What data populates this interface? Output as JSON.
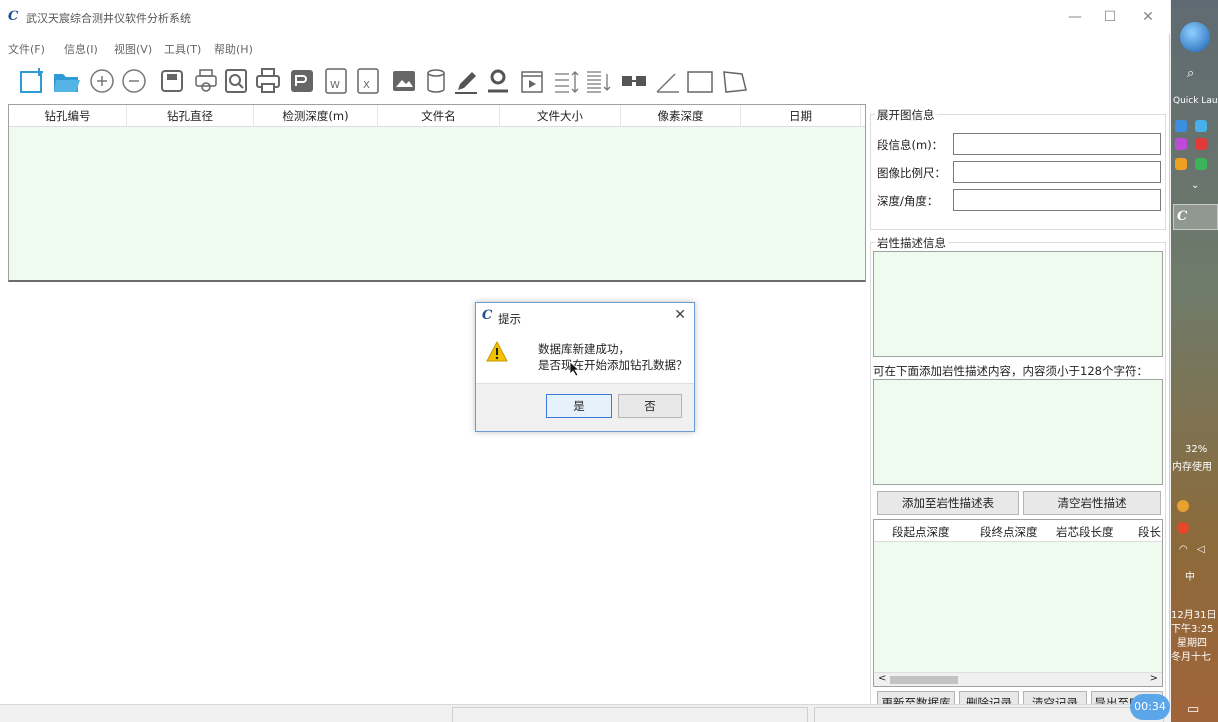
{
  "window": {
    "logo_text": "C",
    "title": "武汉天宸综合测井仪软件分析系统",
    "minimize_glyph": "—",
    "maximize_glyph": "☐",
    "close_glyph": "✕"
  },
  "menu": [
    "文件(F)",
    "信息(I)",
    "视图(V)",
    "工具(T)",
    "帮助(H)"
  ],
  "toolbar_icons": [
    "new-file-icon",
    "open-folder-icon",
    "zoom-in-icon",
    "zoom-out-icon",
    "save-icon",
    "print-setup-icon",
    "print-preview-icon",
    "print-icon",
    "export-image-icon",
    "export-word-icon",
    "export-excel-icon",
    "image-icon",
    "database-icon",
    "pencil-icon",
    "location-icon",
    "video-icon",
    "align-up-icon",
    "align-down-icon",
    "merge-icon",
    "angle-icon",
    "rectangle-icon",
    "polygon-icon"
  ],
  "drill_table": {
    "columns": [
      "钻孔编号",
      "钻孔直径",
      "检测深度(m)",
      "文件名",
      "文件大小",
      "像素深度",
      "日期"
    ]
  },
  "unfold_info": {
    "title": "展开图信息",
    "segment_label": "段信息(m)：",
    "scale_label": "图像比例尺：",
    "depth_angle_label": "深度/角度："
  },
  "lithology": {
    "title": "岩性描述信息",
    "hint": "可在下面添加岩性描述内容，内容须小于128个字符：",
    "add_button": "添加至岩性描述表",
    "clear_button": "清空岩性描述",
    "columns": [
      "段起点深度",
      "段终点深度",
      "岩芯段长度",
      "段长"
    ],
    "scroll_left": "<",
    "scroll_right": ">"
  },
  "actions": {
    "update_db": "更新至数据库",
    "delete_record": "删除记录",
    "clear_records": "清空记录",
    "export_excel": "导出至Excel"
  },
  "dialog": {
    "logo_text": "C",
    "title": "提示",
    "close_glyph": "✕",
    "line1": "数据库新建成功，",
    "line2": "是否现在开始添加钻孔数据？",
    "yes": "是",
    "no": "否"
  },
  "timer": "00:34",
  "taskbar": {
    "quick_launch": "Quick Launch",
    "memory_percent": "32%",
    "memory_label": "内存使用",
    "ime": "中",
    "date": "12月31日",
    "time": "下午3:25",
    "weekday": "星期四",
    "lunar": "冬月十七"
  }
}
